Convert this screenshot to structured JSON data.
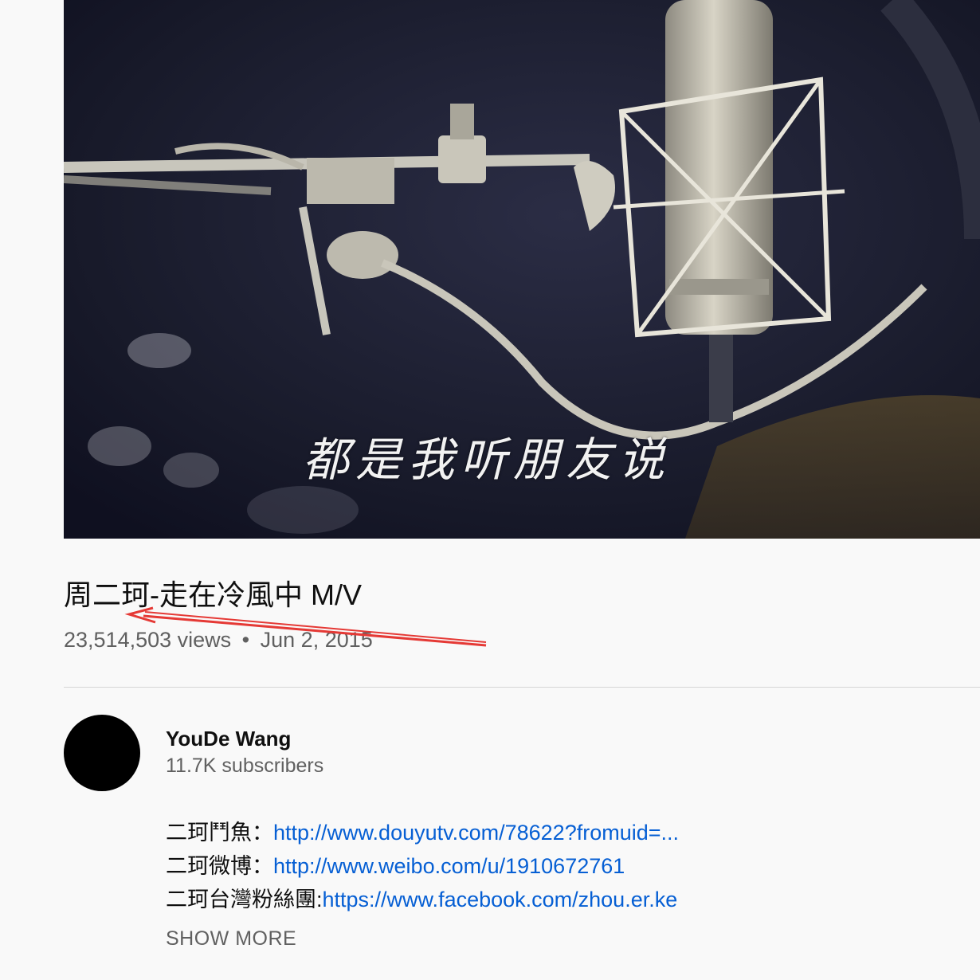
{
  "video": {
    "subtitle": "都是我听朋友说",
    "title": "周二珂-走在冷風中 M/V",
    "views": "23,514,503 views",
    "separator": "•",
    "date": "Jun 2, 2015"
  },
  "channel": {
    "name": "YouDe Wang",
    "subscribers": "11.7K subscribers"
  },
  "description": {
    "lines": [
      {
        "label": "二珂鬥魚：",
        "link": "http://www.douyutv.com/78622?fromuid=..."
      },
      {
        "label": "二珂微博：",
        "link": "http://www.weibo.com/u/1910672761"
      },
      {
        "label": "二珂台灣粉絲團:",
        "link": "https://www.facebook.com/zhou.er.ke"
      }
    ],
    "show_more": "SHOW MORE"
  },
  "colors": {
    "link": "#065fd4",
    "annotation_arrow": "#e53935"
  }
}
